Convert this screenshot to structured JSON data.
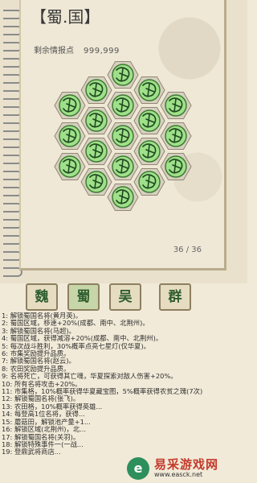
{
  "panel": {
    "title": "【蜀.国】",
    "remaining_label": "剩余情报点",
    "remaining_value": "999,999",
    "page_indicator": "36 / 36"
  },
  "hex_tiles": [
    {
      "name": "hex-tile-1",
      "state": "unlocked"
    },
    {
      "name": "hex-tile-2",
      "state": "unlocked"
    },
    {
      "name": "hex-tile-3",
      "state": "unlocked"
    },
    {
      "name": "hex-tile-4",
      "state": "unlocked"
    },
    {
      "name": "hex-tile-5",
      "state": "unlocked"
    },
    {
      "name": "hex-tile-6",
      "state": "unlocked"
    },
    {
      "name": "hex-tile-7",
      "state": "unlocked"
    },
    {
      "name": "hex-tile-8",
      "state": "unlocked"
    },
    {
      "name": "hex-tile-9",
      "state": "unlocked"
    },
    {
      "name": "hex-tile-10",
      "state": "unlocked"
    },
    {
      "name": "hex-tile-11",
      "state": "unlocked"
    },
    {
      "name": "hex-tile-12",
      "state": "unlocked"
    },
    {
      "name": "hex-tile-13",
      "state": "unlocked"
    },
    {
      "name": "hex-tile-14",
      "state": "unlocked"
    },
    {
      "name": "hex-tile-15",
      "state": "unlocked"
    },
    {
      "name": "hex-tile-16",
      "state": "unlocked"
    },
    {
      "name": "hex-tile-17",
      "state": "unlocked"
    },
    {
      "name": "hex-tile-18",
      "state": "unlocked"
    },
    {
      "name": "hex-tile-19",
      "state": "unlocked"
    }
  ],
  "tabs": [
    {
      "label": "魏",
      "active": false
    },
    {
      "label": "蜀",
      "active": true
    },
    {
      "label": "吴",
      "active": false
    },
    {
      "label": "群",
      "active": false
    }
  ],
  "effects": [
    "1: 解锁蜀国名将(黄月英)。",
    "2: 蜀国区域，移速+20%(成都、南中、北荆州)。",
    "3: 解锁蜀国名将(马超)。",
    "4: 蜀国区域，获得减溶+20%(成都、南中、北荆州)。",
    "5: 每次战斗胜利，30%概率点亮七星灯(仅华夏)。",
    "6: 市集奖励提升品质。",
    "7: 解锁蜀国名将(赵云)。",
    "8: 农田奖励提升品质。",
    "9: 名将死亡，可获得其亡魂，华夏探索对敌人伤害+20%。",
    "10: 所有名将攻击+20%。",
    "11: 市集格，10%概率获得华夏藏宝图，5%概率获得农贫之瑰(7次)",
    "12: 解锁蜀国名将(张飞)。",
    "13: 农田格，10%概率获得英雄...",
    "14: 每登高1位名将，获得...",
    "15: 蘑菇田，解锁池产量+1...",
    "16: 解锁区域(北荆州)，北...",
    "17: 解锁蜀国名将(关羽)。",
    "18: 解锁特殊事件一(一战...",
    "19: 登鼎武将商店..."
  ],
  "watermark": {
    "logo": "e",
    "name": "易采游戏网",
    "url": "www.easck.net"
  },
  "colors": {
    "paper": "#efe8d6",
    "hex_fill": "#9fe08a",
    "hex_frame": "#d6d0c0",
    "glyph_dark": "#1f4a1f",
    "tab_active": "#c7d6a8"
  }
}
